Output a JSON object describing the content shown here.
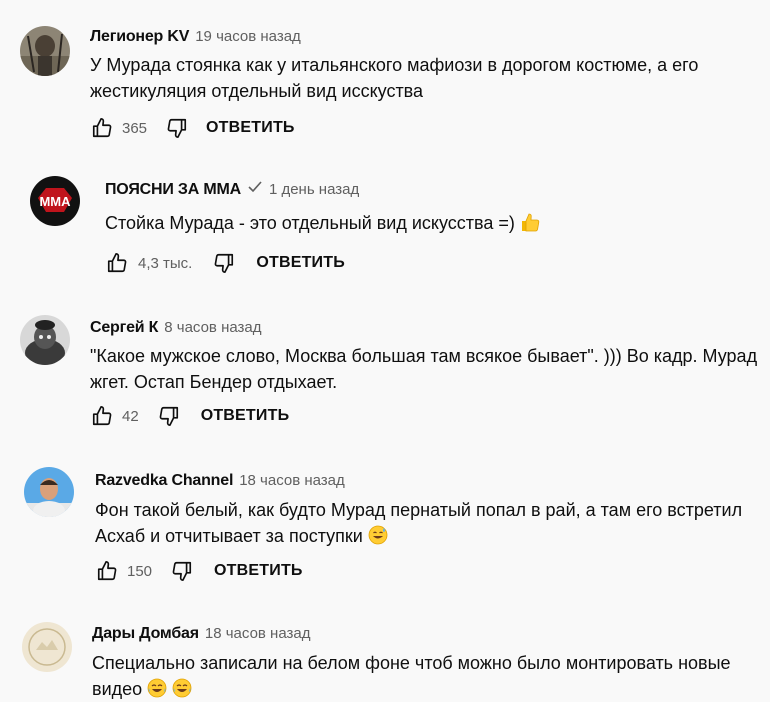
{
  "colors": {
    "background": "#f9f9f9",
    "text": "#0f0f0f",
    "muted": "#606060"
  },
  "comments": [
    {
      "author": "Легионер KV",
      "time": "19 часов назад",
      "text": "У Мурада стоянка как у итальянского мафиози в дорогом костюме, а его жестикуляция отдельный вид исскуства",
      "likes": "365",
      "reply": "ОТВЕТИТЬ"
    },
    {
      "author": "ПОЯСНИ ЗА ММА",
      "verified": true,
      "time": "1 день назад",
      "text": "Стойка Мурада - это отдельный вид искусства =)",
      "text_emoji": "thumbs-up",
      "avatar_text": "MMA",
      "likes": "4,3 тыс.",
      "reply": "ОТВЕТИТЬ"
    },
    {
      "author": "Сергей К",
      "time": "8 часов назад",
      "text": "\"Какое мужское слово, Москва большая там всякое бывает\". ))) Во кадр. Мурад жгет. Остап Бендер отдыхает.",
      "likes": "42",
      "reply": "ОТВЕТИТЬ"
    },
    {
      "author": "Razvedka Channel",
      "time": "18 часов назад",
      "text": "Фон такой белый, как будто Мурад пернатый попал в рай, а там его встретил Асхаб и отчитывает за поступки",
      "text_emoji": "sweat-smile",
      "likes": "150",
      "reply": "ОТВЕТИТЬ"
    },
    {
      "author": "Дары Домбая",
      "time": "18 часов назад",
      "text": "Специально записали на белом фоне чтоб можно было монтировать новые видео",
      "text_emoji": "joy-joy"
    }
  ]
}
